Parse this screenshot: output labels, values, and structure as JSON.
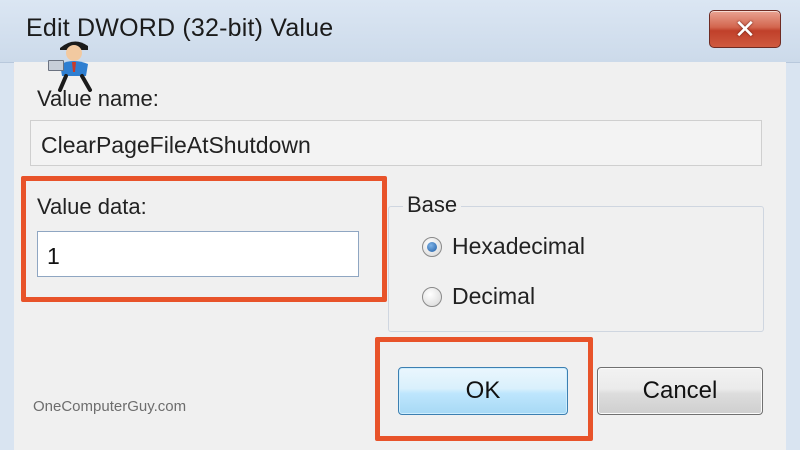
{
  "window": {
    "title": "Edit DWORD (32-bit) Value",
    "close_label": "✕"
  },
  "value_name": {
    "label": "Value name:",
    "value": "ClearPageFileAtShutdown"
  },
  "value_data": {
    "label": "Value data:",
    "value": "1"
  },
  "base": {
    "legend": "Base",
    "options": [
      {
        "label": "Hexadecimal",
        "checked": true
      },
      {
        "label": "Decimal",
        "checked": false
      }
    ]
  },
  "buttons": {
    "ok_label": "OK",
    "cancel_label": "Cancel"
  },
  "watermark": "OneComputerGuy.com",
  "colors": {
    "highlight": "#e8532a",
    "close_button": "#c0402a",
    "window_frame": "#d9e4f1"
  },
  "icons": {
    "logo": "one-computer-guy-logo-icon",
    "close": "close-icon"
  }
}
